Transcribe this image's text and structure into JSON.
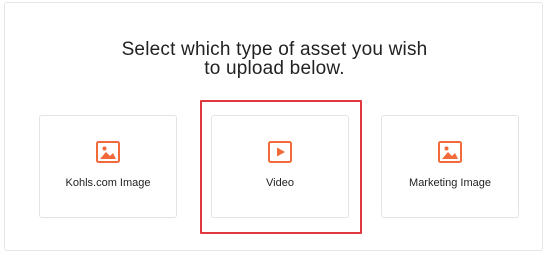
{
  "heading": {
    "line1": "Select which type of asset you wish",
    "line2": "to upload below."
  },
  "options": [
    {
      "label": "Kohls.com Image",
      "icon": "image-icon"
    },
    {
      "label": "Video",
      "icon": "video-play-icon"
    },
    {
      "label": "Marketing Image",
      "icon": "image-icon"
    }
  ],
  "selected_option": "Video",
  "colors": {
    "accent": "#f26a3a",
    "selection": "#e0383e",
    "text": "#222222",
    "border": "#e3e3e3"
  }
}
